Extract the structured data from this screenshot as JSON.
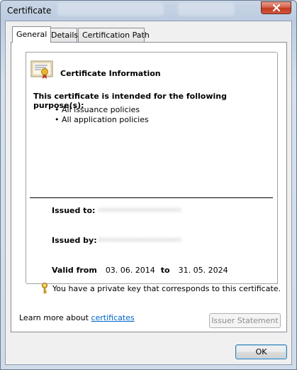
{
  "window": {
    "title": "Certificate",
    "close_icon": "close-icon"
  },
  "tabs": [
    {
      "label": "General",
      "active": true
    },
    {
      "label": "Details",
      "active": false
    },
    {
      "label": "Certification Path",
      "active": false
    }
  ],
  "general": {
    "info_title": "Certificate Information",
    "purpose_title": "This certificate is intended for the following purpose(s):",
    "purposes": [
      "All issuance policies",
      "All application policies"
    ],
    "issued_to_label": "Issued to:",
    "issued_to_value": "••••••••••••••••••••",
    "issued_by_label": "Issued by:",
    "issued_by_value": "••••••••••••••••••••",
    "valid_from_label": "Valid from",
    "valid_from_value": "03. 06. 2014",
    "valid_to_label": "to",
    "valid_to_value": "31. 05. 2024",
    "private_key_note": "You have a private key that corresponds to this certificate.",
    "issuer_statement_button": "Issuer Statement",
    "learn_more_text": "Learn more about ",
    "learn_more_link": "certificates"
  },
  "footer": {
    "ok_button": "OK"
  }
}
